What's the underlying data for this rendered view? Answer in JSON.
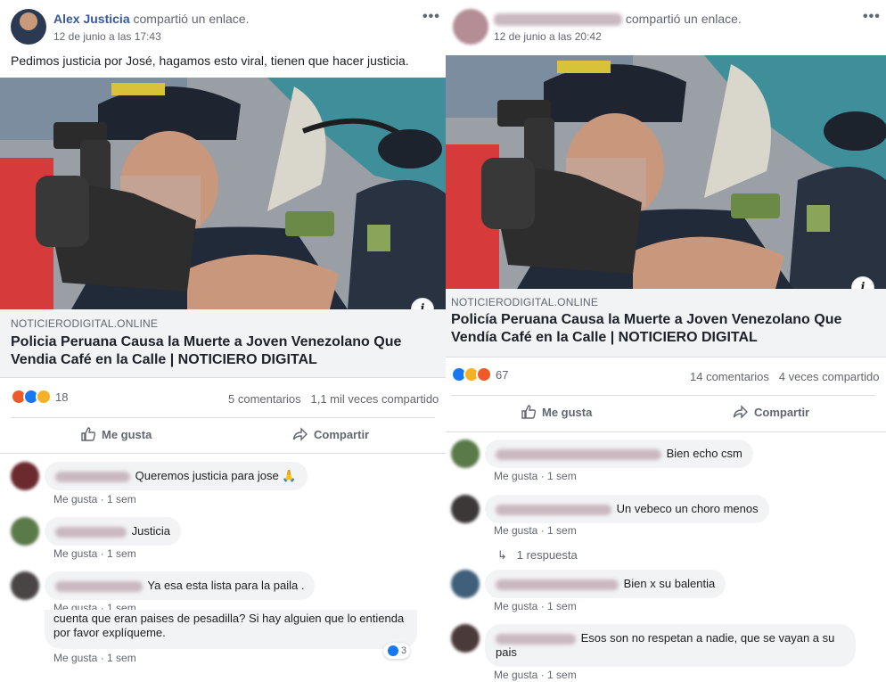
{
  "colors": {
    "link_blue": "#385898",
    "muted": "#606770",
    "bubble": "#f2f3f5",
    "like_blue": "#1877f2",
    "angry": "#f05a28",
    "wow": "#f7b125"
  },
  "left_post": {
    "author": "Alex Justicia",
    "action": "compartió un enlace.",
    "date": "12 de junio a las 17:43",
    "text": "Pedimos justicia por José, hagamos esto viral, tienen que hacer justicia.",
    "link": {
      "domain": "NOTICIERODIGITAL.ONLINE",
      "title_line1": "Policia Peruana Causa la Muerte a Joven Venezolano Que",
      "title_line2": "Vendia Café en la Calle | NOTICIERO DIGITAL"
    },
    "reactions": {
      "icons": [
        "angry",
        "like",
        "sad"
      ],
      "count": "18"
    },
    "stats": {
      "comments": "5 comentarios",
      "shares": "1,1 mil veces compartido"
    },
    "actions": {
      "like": "Me gusta",
      "share": "Compartir"
    },
    "comments": [
      {
        "text": "Queremos justicia para jose 🙏",
        "like": "Me gusta",
        "time": "1 sem"
      },
      {
        "text": "Justicia",
        "like": "Me gusta",
        "time": "1 sem"
      },
      {
        "text": "Ya esa esta lista para la paila .",
        "like": "Me gusta",
        "time": "1 sem"
      }
    ],
    "partial_comment": {
      "line1": "cuenta que eran paises de pesadilla? Si hay alguien que lo entienda",
      "line2": "por favor explíqueme.",
      "reactions": "3",
      "like": "Me gusta",
      "time": "1 sem"
    }
  },
  "right_post": {
    "action": "compartió un enlace.",
    "date": "12 de junio a las 20:42",
    "link": {
      "domain": "NOTICIERODIGITAL.ONLINE",
      "title_line1": "Policía Peruana Causa la Muerte a Joven Venezolano Que",
      "title_line2": "Vendía Café en la Calle | NOTICIERO DIGITAL"
    },
    "reactions": {
      "icons": [
        "like",
        "wow",
        "angry"
      ],
      "count": "67"
    },
    "stats": {
      "comments": "14 comentarios",
      "shares": "4 veces compartido"
    },
    "actions": {
      "like": "Me gusta",
      "share": "Compartir"
    },
    "comments": [
      {
        "text": "Bien echo csm",
        "like": "Me gusta",
        "time": "1 sem"
      },
      {
        "text": "Un vebeco un choro menos",
        "like": "Me gusta",
        "time": "1 sem"
      },
      {
        "text": "Bien x su balentia",
        "like": "Me gusta",
        "time": "1 sem"
      },
      {
        "text_line1": "Esos son no respetan a nadie, que se vayan a su",
        "text_line2": "pais",
        "like": "Me gusta",
        "time": "1 sem"
      }
    ],
    "reply_count": "1 respuesta"
  }
}
